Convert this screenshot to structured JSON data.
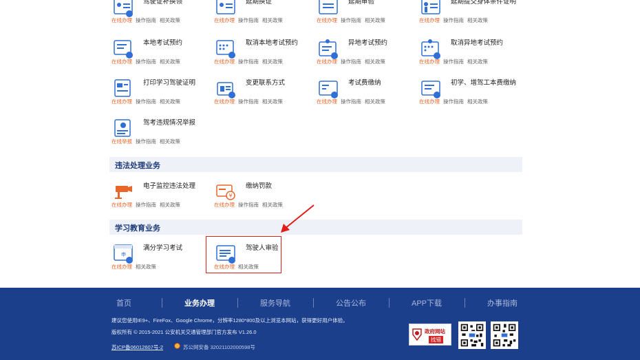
{
  "sections": {
    "violation": "违法处理业务",
    "study": "学习教育业务"
  },
  "services": [
    {
      "name": "驾驶证补换领",
      "links": [
        "在线办理",
        "操作指南",
        "相关政策"
      ],
      "icon": "driver-license-icon"
    },
    {
      "name": "延期换证",
      "links": [
        "在线办理",
        "操作指南",
        "相关政策"
      ],
      "icon": "license-renew-icon"
    },
    {
      "name": "延期审验",
      "links": [
        "在线办理",
        "操作指南",
        "相关政策"
      ],
      "icon": "license-review-icon"
    },
    {
      "name": "延期提交身体条件证明",
      "links": [
        "在线办理",
        "操作指南",
        "相关政策"
      ],
      "icon": "health-cert-icon"
    },
    {
      "name": "本地考试预约",
      "links": [
        "在线办理",
        "操作指南",
        "相关政策"
      ],
      "icon": "exam-booking-icon"
    },
    {
      "name": "取消本地考试预约",
      "links": [
        "在线办理",
        "操作指南",
        "相关政策"
      ],
      "icon": "cancel-booking-icon"
    },
    {
      "name": "异地考试预约",
      "links": [
        "在线办理",
        "操作指南",
        "相关政策"
      ],
      "icon": "remote-exam-icon"
    },
    {
      "name": "取消异地考试预约",
      "links": [
        "在线办理",
        "操作指南",
        "相关政策"
      ],
      "icon": "cancel-remote-icon"
    },
    {
      "name": "打印学习驾驶证明",
      "links": [
        "在线办理",
        "操作指南",
        "相关政策"
      ],
      "icon": "print-cert-icon"
    },
    {
      "name": "变更联系方式",
      "links": [
        "在线办理",
        "操作指南",
        "相关政策"
      ],
      "icon": "contact-change-icon"
    },
    {
      "name": "考试费缴纳",
      "links": [
        "在线办理",
        "操作指南",
        "相关政策"
      ],
      "icon": "exam-fee-icon"
    },
    {
      "name": "初学、增驾工本费缴纳",
      "links": [
        "在线办理",
        "操作指南",
        "相关政策"
      ],
      "icon": "cost-fee-icon"
    },
    {
      "name": "驾考违规情况举报",
      "links": [
        "在线举报",
        "操作指南",
        "相关政策"
      ],
      "icon": "report-icon"
    },
    {
      "name": "电子监控违法处理",
      "links": [
        "在线办理",
        "操作指南",
        "相关政策"
      ],
      "icon": "camera-icon"
    },
    {
      "name": "缴纳罚款",
      "links": [
        "在线办理",
        "操作指南",
        "相关政策"
      ],
      "icon": "fine-payment-icon"
    },
    {
      "name": "满分学习考试",
      "links": [
        "在线办理",
        "相关政策"
      ],
      "icon": "full-score-study-icon"
    },
    {
      "name": "驾驶人审验",
      "links": [
        "在线办理",
        "相关政策"
      ],
      "icon": "driver-review-icon"
    }
  ],
  "footer": {
    "nav": [
      "首页",
      "业务办理",
      "服务导航",
      "公告公布",
      "APP下载",
      "办事指南"
    ],
    "notice": "建议您使用IE9+、FireFox、Google Chrome，分辨率1280*800及以上浏览本网站，获得更好用户体验。",
    "copyright": "版权所有 © 2015-2021 公安机关交通管理部门官方发布 V1.26.0",
    "icp": "苏ICP备06012607号-2",
    "police_record": "苏公网安备 32021102000598号",
    "gov_badge_line1": "政府网站",
    "gov_badge_line2": "找错"
  },
  "colors": {
    "footer_bg": "#1c3f8c",
    "accent_orange": "#e8662a",
    "icon_blue": "#2f6fd6",
    "highlight_red": "#e21b1b"
  }
}
